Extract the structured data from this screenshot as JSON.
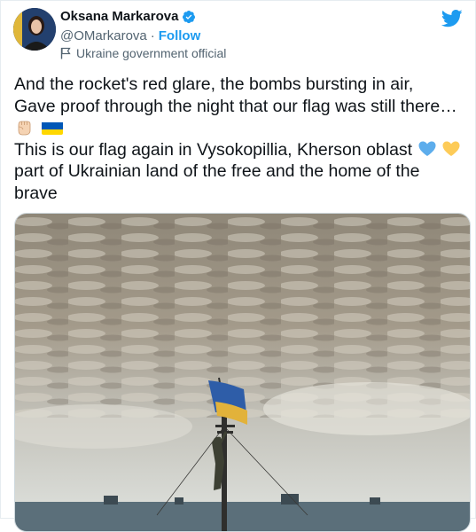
{
  "author": {
    "display_name": "Oksana Markarova",
    "handle": "@OMarkarova",
    "separator": "·",
    "follow_label": "Follow",
    "affiliation_label": "Ukraine government official"
  },
  "tweet": {
    "line1": "And the rocket's red glare, the bombs bursting in air,",
    "line2": "Gave proof through the night that our flag was still there…",
    "line4": "This is our flag again in Vysokopillia, Kherson oblast",
    "line5": "part of Ukrainian land of the free and the home of the",
    "line6": "brave"
  },
  "icons": [
    "verified-icon",
    "twitter-bird-icon",
    "government-flag-icon",
    "raised-fist-emoji",
    "ukraine-flag-emoji",
    "blue-heart-emoji",
    "yellow-heart-emoji"
  ],
  "colors": {
    "accent": "#1d9bf0",
    "secondary_text": "#536471",
    "flag_blue": "#0057b7",
    "flag_yellow": "#ffd700"
  }
}
